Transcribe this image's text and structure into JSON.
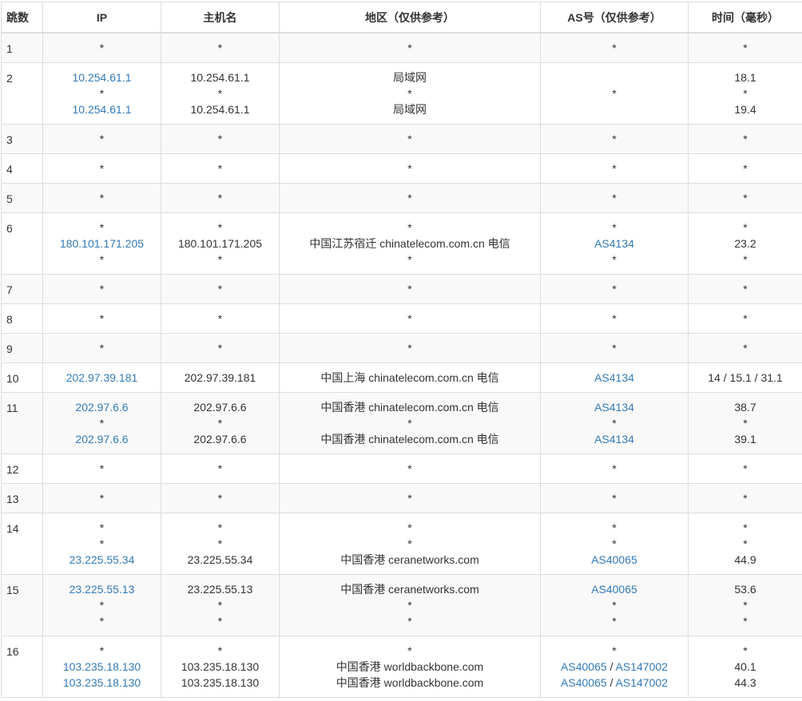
{
  "header": {
    "hop": "跳数",
    "ip": "IP",
    "hostname": "主机名",
    "region": "地区（仅供参考）",
    "asn": "AS号（仅供参考）",
    "time": "时间（毫秒）"
  },
  "rows": [
    {
      "hop": "1",
      "ip": [
        "*"
      ],
      "hostname": [
        "*"
      ],
      "region": [
        "*"
      ],
      "as": [
        [
          "*"
        ]
      ],
      "time": [
        "*"
      ]
    },
    {
      "hop": "2",
      "ip": [
        "10.254.61.1",
        "*",
        "10.254.61.1"
      ],
      "hostname": [
        "10.254.61.1",
        "*",
        "10.254.61.1"
      ],
      "region": [
        "局域网",
        "*",
        "局域网"
      ],
      "as": [
        [
          "*"
        ]
      ],
      "time": [
        "18.1",
        "*",
        "19.4"
      ]
    },
    {
      "hop": "3",
      "ip": [
        "*"
      ],
      "hostname": [
        "*"
      ],
      "region": [
        "*"
      ],
      "as": [
        [
          "*"
        ]
      ],
      "time": [
        "*"
      ]
    },
    {
      "hop": "4",
      "ip": [
        "*"
      ],
      "hostname": [
        "*"
      ],
      "region": [
        "*"
      ],
      "as": [
        [
          "*"
        ]
      ],
      "time": [
        "*"
      ]
    },
    {
      "hop": "5",
      "ip": [
        "*"
      ],
      "hostname": [
        "*"
      ],
      "region": [
        "*"
      ],
      "as": [
        [
          "*"
        ]
      ],
      "time": [
        "*"
      ]
    },
    {
      "hop": "6",
      "ip": [
        "*",
        "180.101.171.205",
        "*"
      ],
      "hostname": [
        "*",
        "180.101.171.205",
        "*"
      ],
      "region": [
        "*",
        "中国江苏宿迁 chinatelecom.com.cn 电信",
        "*"
      ],
      "as": [
        [
          "*"
        ],
        [
          "AS4134"
        ],
        [
          "*"
        ]
      ],
      "time": [
        "*",
        "23.2",
        "*"
      ]
    },
    {
      "hop": "7",
      "ip": [
        "*"
      ],
      "hostname": [
        "*"
      ],
      "region": [
        "*"
      ],
      "as": [
        [
          "*"
        ]
      ],
      "time": [
        "*"
      ]
    },
    {
      "hop": "8",
      "ip": [
        "*"
      ],
      "hostname": [
        "*"
      ],
      "region": [
        "*"
      ],
      "as": [
        [
          "*"
        ]
      ],
      "time": [
        "*"
      ]
    },
    {
      "hop": "9",
      "ip": [
        "*"
      ],
      "hostname": [
        "*"
      ],
      "region": [
        "*"
      ],
      "as": [
        [
          "*"
        ]
      ],
      "time": [
        "*"
      ]
    },
    {
      "hop": "10",
      "ip": [
        "202.97.39.181"
      ],
      "hostname": [
        "202.97.39.181"
      ],
      "region": [
        "中国上海 chinatelecom.com.cn 电信"
      ],
      "as": [
        [
          "AS4134"
        ]
      ],
      "time": [
        "14 / 15.1 / 31.1"
      ]
    },
    {
      "hop": "11",
      "ip": [
        "202.97.6.6",
        "*",
        "202.97.6.6"
      ],
      "hostname": [
        "202.97.6.6",
        "*",
        "202.97.6.6"
      ],
      "region": [
        "中国香港 chinatelecom.com.cn 电信",
        "*",
        "中国香港 chinatelecom.com.cn 电信"
      ],
      "as": [
        [
          "AS4134"
        ],
        [
          "*"
        ],
        [
          "AS4134"
        ]
      ],
      "time": [
        "38.7",
        "*",
        "39.1"
      ]
    },
    {
      "hop": "12",
      "ip": [
        "*"
      ],
      "hostname": [
        "*"
      ],
      "region": [
        "*"
      ],
      "as": [
        [
          "*"
        ]
      ],
      "time": [
        "*"
      ]
    },
    {
      "hop": "13",
      "ip": [
        "*"
      ],
      "hostname": [
        "*"
      ],
      "region": [
        "*"
      ],
      "as": [
        [
          "*"
        ]
      ],
      "time": [
        "*"
      ]
    },
    {
      "hop": "14",
      "ip": [
        "*",
        "*",
        "23.225.55.34"
      ],
      "hostname": [
        "*",
        "*",
        "23.225.55.34"
      ],
      "region": [
        "*",
        "*",
        "中国香港 ceranetworks.com"
      ],
      "as": [
        [
          "*"
        ],
        [
          "*"
        ],
        [
          "AS40065"
        ]
      ],
      "time": [
        "*",
        "*",
        "44.9"
      ]
    },
    {
      "hop": "15",
      "ip": [
        "23.225.55.13",
        "*",
        "*"
      ],
      "hostname": [
        "23.225.55.13",
        "*",
        "*"
      ],
      "region": [
        "中国香港 ceranetworks.com",
        "*",
        "*"
      ],
      "as": [
        [
          "AS40065"
        ],
        [
          "*"
        ],
        [
          "*"
        ]
      ],
      "time": [
        "53.6",
        "*",
        "*"
      ]
    },
    {
      "hop": "16",
      "ip": [
        "*",
        "103.235.18.130",
        "103.235.18.130"
      ],
      "hostname": [
        "*",
        "103.235.18.130",
        "103.235.18.130"
      ],
      "region": [
        "*",
        "中国香港 worldbackbone.com",
        "中国香港 worldbackbone.com"
      ],
      "as": [
        [
          "*"
        ],
        [
          "AS40065",
          "AS147002"
        ],
        [
          "AS40065",
          "AS147002"
        ]
      ],
      "time": [
        "*",
        "40.1",
        "44.3"
      ]
    }
  ],
  "colors": {
    "link": "#337ab7",
    "text": "#333333",
    "border": "#dddddd",
    "stripe": "#f9f9f9"
  }
}
